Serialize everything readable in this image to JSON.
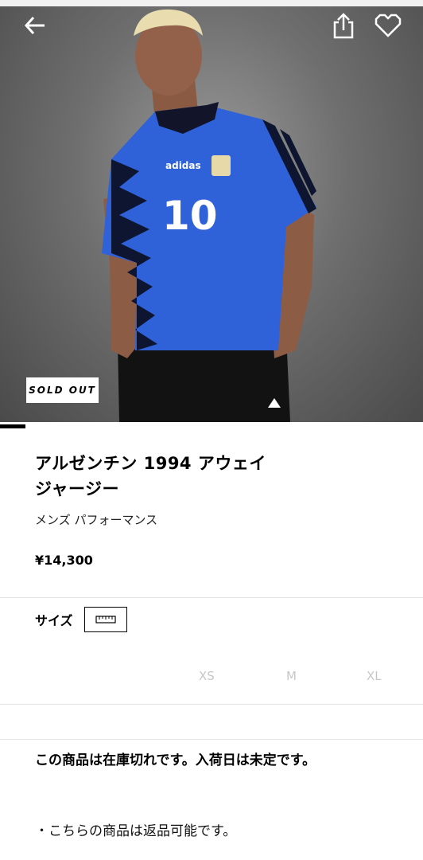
{
  "icons": {
    "back": "arrow-left-icon",
    "share": "share-icon",
    "favorite": "heart-icon",
    "size_guide": "ruler-icon"
  },
  "hero": {
    "badge": "SOLD OUT",
    "jersey_brand": "adidas",
    "jersey_number": "10"
  },
  "product": {
    "title_line1": "アルゼンチン 1994 アウェイ",
    "title_line2": "ジャージー",
    "category": "メンズ パフォーマンス",
    "price": "¥14,300"
  },
  "size_section": {
    "label": "サイズ",
    "options": [
      "XS",
      "M",
      "XL"
    ]
  },
  "messages": {
    "stock": "この商品は在庫切れです。入荷日は未定です。",
    "returns": "・こちらの商品は返品可能です。"
  },
  "colors": {
    "jersey_blue": "#2f62d8",
    "size_disabled": "#c7c7c7"
  }
}
